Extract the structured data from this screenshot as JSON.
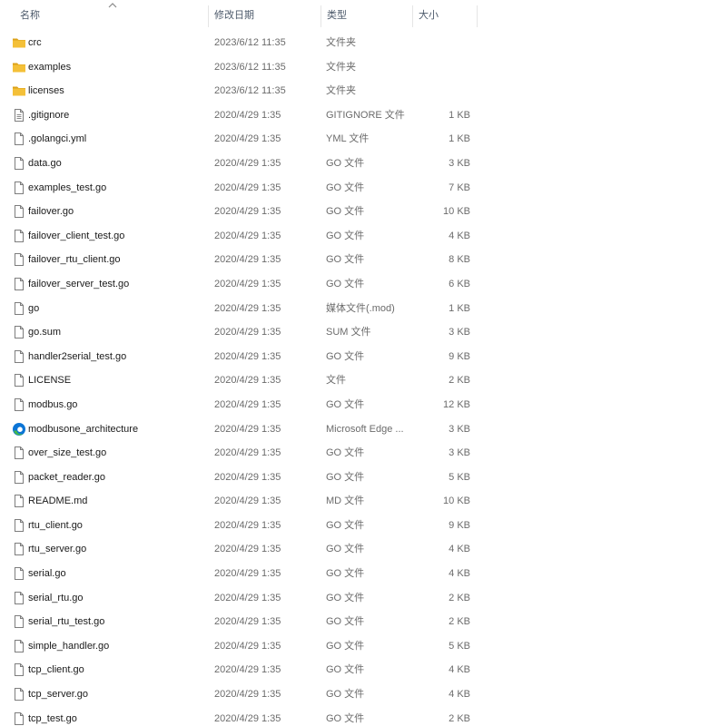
{
  "columns": {
    "name": "名称",
    "modified": "修改日期",
    "type": "类型",
    "size": "大小"
  },
  "sort": {
    "column": "name",
    "direction": "ascending"
  },
  "colors": {
    "folder": "#f4c038",
    "folder_dark": "#dca21a",
    "file_outline": "#7d7d7d",
    "edge_blue": "#0c75d6",
    "edge_green": "#46b94a"
  },
  "files": [
    {
      "name": "crc",
      "modified": "2023/6/12 11:35",
      "type": "文件夹",
      "size": "",
      "icon": "folder-icon"
    },
    {
      "name": "examples",
      "modified": "2023/6/12 11:35",
      "type": "文件夹",
      "size": "",
      "icon": "folder-icon"
    },
    {
      "name": "licenses",
      "modified": "2023/6/12 11:35",
      "type": "文件夹",
      "size": "",
      "icon": "folder-icon"
    },
    {
      "name": ".gitignore",
      "modified": "2020/4/29 1:35",
      "type": "GITIGNORE 文件",
      "size": "1 KB",
      "icon": "text-file-icon"
    },
    {
      "name": ".golangci.yml",
      "modified": "2020/4/29 1:35",
      "type": "YML 文件",
      "size": "1 KB",
      "icon": "file-icon"
    },
    {
      "name": "data.go",
      "modified": "2020/4/29 1:35",
      "type": "GO 文件",
      "size": "3 KB",
      "icon": "file-icon"
    },
    {
      "name": "examples_test.go",
      "modified": "2020/4/29 1:35",
      "type": "GO 文件",
      "size": "7 KB",
      "icon": "file-icon"
    },
    {
      "name": "failover.go",
      "modified": "2020/4/29 1:35",
      "type": "GO 文件",
      "size": "10 KB",
      "icon": "file-icon"
    },
    {
      "name": "failover_client_test.go",
      "modified": "2020/4/29 1:35",
      "type": "GO 文件",
      "size": "4 KB",
      "icon": "file-icon"
    },
    {
      "name": "failover_rtu_client.go",
      "modified": "2020/4/29 1:35",
      "type": "GO 文件",
      "size": "8 KB",
      "icon": "file-icon"
    },
    {
      "name": "failover_server_test.go",
      "modified": "2020/4/29 1:35",
      "type": "GO 文件",
      "size": "6 KB",
      "icon": "file-icon"
    },
    {
      "name": "go",
      "modified": "2020/4/29 1:35",
      "type": "媒体文件(.mod)",
      "size": "1 KB",
      "icon": "file-icon"
    },
    {
      "name": "go.sum",
      "modified": "2020/4/29 1:35",
      "type": "SUM 文件",
      "size": "3 KB",
      "icon": "file-icon"
    },
    {
      "name": "handler2serial_test.go",
      "modified": "2020/4/29 1:35",
      "type": "GO 文件",
      "size": "9 KB",
      "icon": "file-icon"
    },
    {
      "name": "LICENSE",
      "modified": "2020/4/29 1:35",
      "type": "文件",
      "size": "2 KB",
      "icon": "file-icon"
    },
    {
      "name": "modbus.go",
      "modified": "2020/4/29 1:35",
      "type": "GO 文件",
      "size": "12 KB",
      "icon": "file-icon"
    },
    {
      "name": "modbusone_architecture",
      "modified": "2020/4/29 1:35",
      "type": "Microsoft Edge ...",
      "size": "3 KB",
      "icon": "edge-icon"
    },
    {
      "name": "over_size_test.go",
      "modified": "2020/4/29 1:35",
      "type": "GO 文件",
      "size": "3 KB",
      "icon": "file-icon"
    },
    {
      "name": "packet_reader.go",
      "modified": "2020/4/29 1:35",
      "type": "GO 文件",
      "size": "5 KB",
      "icon": "file-icon"
    },
    {
      "name": "README.md",
      "modified": "2020/4/29 1:35",
      "type": "MD 文件",
      "size": "10 KB",
      "icon": "file-icon"
    },
    {
      "name": "rtu_client.go",
      "modified": "2020/4/29 1:35",
      "type": "GO 文件",
      "size": "9 KB",
      "icon": "file-icon"
    },
    {
      "name": "rtu_server.go",
      "modified": "2020/4/29 1:35",
      "type": "GO 文件",
      "size": "4 KB",
      "icon": "file-icon"
    },
    {
      "name": "serial.go",
      "modified": "2020/4/29 1:35",
      "type": "GO 文件",
      "size": "4 KB",
      "icon": "file-icon"
    },
    {
      "name": "serial_rtu.go",
      "modified": "2020/4/29 1:35",
      "type": "GO 文件",
      "size": "2 KB",
      "icon": "file-icon"
    },
    {
      "name": "serial_rtu_test.go",
      "modified": "2020/4/29 1:35",
      "type": "GO 文件",
      "size": "2 KB",
      "icon": "file-icon"
    },
    {
      "name": "simple_handler.go",
      "modified": "2020/4/29 1:35",
      "type": "GO 文件",
      "size": "5 KB",
      "icon": "file-icon"
    },
    {
      "name": "tcp_client.go",
      "modified": "2020/4/29 1:35",
      "type": "GO 文件",
      "size": "4 KB",
      "icon": "file-icon"
    },
    {
      "name": "tcp_server.go",
      "modified": "2020/4/29 1:35",
      "type": "GO 文件",
      "size": "4 KB",
      "icon": "file-icon"
    },
    {
      "name": "tcp_test.go",
      "modified": "2020/4/29 1:35",
      "type": "GO 文件",
      "size": "2 KB",
      "icon": "file-icon"
    }
  ]
}
